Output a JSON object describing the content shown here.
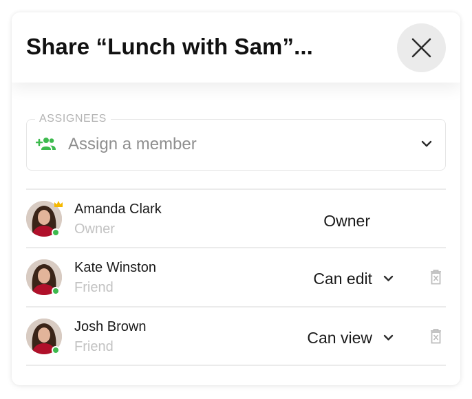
{
  "dialog": {
    "title": "Share “Lunch with Sam”...",
    "close_icon": "close-icon"
  },
  "assignees": {
    "legend": "ASSIGNEES",
    "placeholder": "Assign a member",
    "icon": "add-people-icon",
    "icon_color": "#3dba4e",
    "dropdown_icon": "chevron-down-icon"
  },
  "members": [
    {
      "name": "Amanda Clark",
      "role": "Owner",
      "permission": "Owner",
      "is_owner": true,
      "online": true
    },
    {
      "name": "Kate Winston",
      "role": "Friend",
      "permission": "Can edit",
      "is_owner": false,
      "online": true
    },
    {
      "name": "Josh Brown",
      "role": "Friend",
      "permission": "Can view",
      "is_owner": false,
      "online": true
    }
  ],
  "colors": {
    "online": "#3dba4e",
    "crown": "#f5b800",
    "placeholder": "#8f8f8f",
    "muted": "#c2c2c2"
  }
}
